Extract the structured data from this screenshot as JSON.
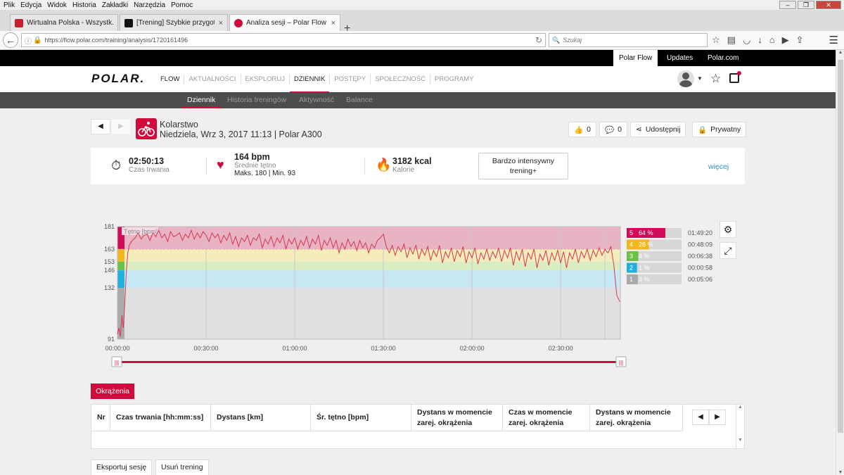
{
  "browser": {
    "menu": [
      "Plik",
      "Edycja",
      "Widok",
      "Historia",
      "Zakładki",
      "Narzędzia",
      "Pomoc"
    ],
    "tabs": [
      {
        "label": "Wirtualna Polska - Wszystk...",
        "favicon_color": "#c8202b"
      },
      {
        "label": "[Trening] Szybkie przygoto...",
        "favicon_color": "#111111"
      },
      {
        "label": "Analiza sesji – Polar Flow",
        "favicon_color": "#d10a3c"
      }
    ],
    "new_tab": "+",
    "url": "https://flow.polar.com/training/analysis/1720161496",
    "search_placeholder": "Szukaj"
  },
  "topbar": {
    "items": [
      "Polar Flow",
      "Updates",
      "Polar.com"
    ]
  },
  "nav": {
    "logo": "POLAR.",
    "flow": "FLOW",
    "items": [
      "AKTUALNOŚCI",
      "EKSPLORUJ",
      "DZIENNIK",
      "POSTĘPY",
      "SPOŁECZNOŚĆ",
      "PROGRAMY"
    ]
  },
  "subnav": {
    "items": [
      "Dziennik",
      "Historia treningów",
      "Aktywność",
      "Balance"
    ]
  },
  "session": {
    "sport": "Kolarstwo",
    "subtitle": "Niedziela, Wrz 3, 2017 11:13 | Polar A300",
    "likes": "0",
    "comments": "0",
    "share": "Udostępnij",
    "privacy": "Prywatny"
  },
  "summary": {
    "duration": "02:50:13",
    "duration_label": "Czas trwania",
    "hr": "164 bpm",
    "hr_label": "Średnie tętno",
    "hr_minmax": "Maks. 180 | Min. 93",
    "calories": "3182 kcal",
    "calories_label": "Kalorie",
    "intensity_line1": "Bardzo intensywny",
    "intensity_line2": "trening+",
    "more": "więcej"
  },
  "chart_data": {
    "type": "line",
    "series_label": "Tętno [bpm]",
    "y_ticks": [
      181,
      163,
      153,
      146,
      132,
      91
    ],
    "ylim": [
      91,
      181
    ],
    "x_ticks": [
      "00:00:00",
      "00:30:00",
      "01:00:00",
      "01:30:00",
      "02:00:00",
      "02:30:00"
    ],
    "x_tick_minutes": [
      0,
      30,
      60,
      90,
      120,
      150
    ],
    "xlim_minutes": [
      0,
      170.2
    ],
    "zones": [
      {
        "zone": "5",
        "lower": 163,
        "upper": 181,
        "percent": "64 %",
        "time": "01:49:20",
        "color": "#e8b4c4",
        "bar_color": "#d10a5a",
        "fraction": 0.64
      },
      {
        "zone": "4",
        "lower": 153,
        "upper": 163,
        "percent": "28 %",
        "time": "00:48:09",
        "color": "#f5ecbc",
        "bar_color": "#f1b71c",
        "fraction": 0.28
      },
      {
        "zone": "3",
        "lower": 146,
        "upper": 153,
        "percent": "4 %",
        "time": "00:06:38",
        "color": "#d9ecc2",
        "bar_color": "#6cc04a",
        "fraction": 0.04
      },
      {
        "zone": "2",
        "lower": 132,
        "upper": 146,
        "percent": "1 %",
        "time": "00:00:58",
        "color": "#c6e7f3",
        "bar_color": "#1fb0dd",
        "fraction": 0.01
      },
      {
        "zone": "1",
        "lower": 91,
        "upper": 132,
        "percent": "3 %",
        "time": "00:05:06",
        "color": "#e0e0e0",
        "bar_color": "#aaaaaa",
        "fraction": 0.03
      }
    ],
    "line_color": "#d9364f",
    "points": [
      [
        0,
        95
      ],
      [
        0.5,
        100
      ],
      [
        1,
        93
      ],
      [
        1.5,
        110
      ],
      [
        2,
        100
      ],
      [
        2.5,
        120
      ],
      [
        3,
        145
      ],
      [
        3.5,
        160
      ],
      [
        4,
        166
      ],
      [
        5,
        170
      ],
      [
        6,
        172
      ],
      [
        7,
        176
      ],
      [
        8,
        171
      ],
      [
        9,
        174
      ],
      [
        10,
        175
      ],
      [
        11,
        170
      ],
      [
        12,
        176
      ],
      [
        13,
        173
      ],
      [
        14,
        178
      ],
      [
        15,
        172
      ],
      [
        16,
        175
      ],
      [
        17,
        169
      ],
      [
        18,
        177
      ],
      [
        19,
        173
      ],
      [
        20,
        174
      ],
      [
        21,
        176
      ],
      [
        22,
        170
      ],
      [
        23,
        175
      ],
      [
        24,
        172
      ],
      [
        25,
        178
      ],
      [
        26,
        171
      ],
      [
        27,
        176
      ],
      [
        28,
        172
      ],
      [
        29,
        177
      ],
      [
        30,
        174
      ],
      [
        31,
        169
      ],
      [
        32,
        176
      ],
      [
        33,
        172
      ],
      [
        34,
        175
      ],
      [
        35,
        168
      ],
      [
        36,
        174
      ],
      [
        37,
        170
      ],
      [
        38,
        176
      ],
      [
        39,
        167
      ],
      [
        40,
        173
      ],
      [
        41,
        165
      ],
      [
        42,
        172
      ],
      [
        43,
        169
      ],
      [
        44,
        174
      ],
      [
        45,
        166
      ],
      [
        46,
        172
      ],
      [
        47,
        170
      ],
      [
        48,
        175
      ],
      [
        49,
        164
      ],
      [
        50,
        171
      ],
      [
        51,
        167
      ],
      [
        52,
        173
      ],
      [
        53,
        165
      ],
      [
        54,
        172
      ],
      [
        55,
        168
      ],
      [
        56,
        174
      ],
      [
        57,
        163
      ],
      [
        58,
        171
      ],
      [
        59,
        167
      ],
      [
        60,
        172
      ],
      [
        61,
        163
      ],
      [
        62,
        170
      ],
      [
        63,
        166
      ],
      [
        64,
        173
      ],
      [
        65,
        164
      ],
      [
        66,
        171
      ],
      [
        67,
        167
      ],
      [
        68,
        174
      ],
      [
        69,
        162
      ],
      [
        70,
        170
      ],
      [
        71,
        166
      ],
      [
        72,
        172
      ],
      [
        73,
        164
      ],
      [
        74,
        170
      ],
      [
        75,
        160
      ],
      [
        76,
        168
      ],
      [
        77,
        163
      ],
      [
        78,
        171
      ],
      [
        79,
        165
      ],
      [
        80,
        169
      ],
      [
        81,
        162
      ],
      [
        82,
        170
      ],
      [
        83,
        164
      ],
      [
        84,
        168
      ],
      [
        85,
        160
      ],
      [
        86,
        167
      ],
      [
        87,
        164
      ],
      [
        88,
        170
      ],
      [
        89,
        172
      ],
      [
        90,
        175
      ],
      [
        91,
        165
      ],
      [
        92,
        160
      ],
      [
        93,
        166
      ],
      [
        94,
        158
      ],
      [
        95,
        165
      ],
      [
        96,
        161
      ],
      [
        97,
        167
      ],
      [
        98,
        156
      ],
      [
        99,
        164
      ],
      [
        100,
        159
      ],
      [
        101,
        166
      ],
      [
        102,
        155
      ],
      [
        103,
        163
      ],
      [
        104,
        158
      ],
      [
        105,
        165
      ],
      [
        106,
        154
      ],
      [
        107,
        162
      ],
      [
        108,
        157
      ],
      [
        109,
        166
      ],
      [
        110,
        152
      ],
      [
        111,
        161
      ],
      [
        112,
        156
      ],
      [
        113,
        164
      ],
      [
        114,
        153
      ],
      [
        115,
        162
      ],
      [
        116,
        157
      ],
      [
        117,
        165
      ],
      [
        118,
        152
      ],
      [
        119,
        161
      ],
      [
        120,
        156
      ],
      [
        121,
        164
      ],
      [
        122,
        151
      ],
      [
        123,
        160
      ],
      [
        124,
        155
      ],
      [
        125,
        163
      ],
      [
        126,
        154
      ],
      [
        127,
        161
      ],
      [
        128,
        156
      ],
      [
        129,
        164
      ],
      [
        130,
        153
      ],
      [
        131,
        162
      ],
      [
        132,
        156
      ],
      [
        133,
        164
      ],
      [
        134,
        150
      ],
      [
        135,
        161
      ],
      [
        136,
        154
      ],
      [
        137,
        163
      ],
      [
        138,
        149
      ],
      [
        139,
        160
      ],
      [
        140,
        155
      ],
      [
        141,
        163
      ],
      [
        142,
        148
      ],
      [
        143,
        159
      ],
      [
        144,
        154
      ],
      [
        145,
        162
      ],
      [
        146,
        150
      ],
      [
        147,
        160
      ],
      [
        148,
        154
      ],
      [
        149,
        162
      ],
      [
        150,
        152
      ],
      [
        151,
        161
      ],
      [
        152,
        148
      ],
      [
        153,
        160
      ],
      [
        154,
        155
      ],
      [
        155,
        163
      ],
      [
        156,
        152
      ],
      [
        157,
        161
      ],
      [
        158,
        156
      ],
      [
        159,
        163
      ],
      [
        160,
        154
      ],
      [
        161,
        162
      ],
      [
        162,
        157
      ],
      [
        163,
        164
      ],
      [
        164,
        158
      ],
      [
        165,
        163
      ],
      [
        166,
        160
      ],
      [
        167,
        165
      ],
      [
        168,
        150
      ],
      [
        169,
        126
      ],
      [
        170,
        121
      ]
    ]
  },
  "laps": {
    "tab": "Okrążenia",
    "columns": [
      "Nr",
      "Czas trwania [hh:mm:ss]",
      "Dystans [km]",
      "Śr. tętno [bpm]",
      "Dystans w momencie zarej. okrążenia",
      "Czas w momencie zarej. okrążenia",
      "Dystans w momencie zarej. okrążenia"
    ]
  },
  "bottom": {
    "export": "Eksportuj sesję",
    "delete": "Usuń trening"
  }
}
